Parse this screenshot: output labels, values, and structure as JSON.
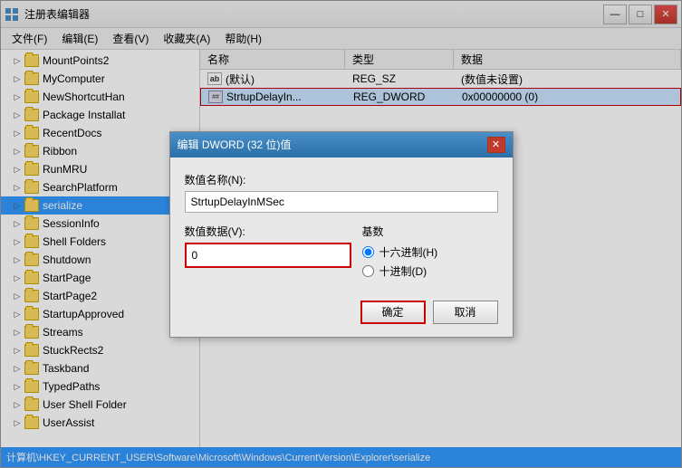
{
  "window": {
    "title": "注册表编辑器",
    "icon": "regedit",
    "controls": {
      "minimize": "—",
      "maximize": "□",
      "close": "✕"
    }
  },
  "menu": {
    "items": [
      {
        "label": "文件(F)"
      },
      {
        "label": "编辑(E)"
      },
      {
        "label": "查看(V)"
      },
      {
        "label": "收藏夹(A)"
      },
      {
        "label": "帮助(H)"
      }
    ]
  },
  "tree": {
    "items": [
      {
        "label": "MountPoints2",
        "indent": 1
      },
      {
        "label": "MyComputer",
        "indent": 1
      },
      {
        "label": "NewShortcutHan",
        "indent": 1
      },
      {
        "label": "Package Installat",
        "indent": 1
      },
      {
        "label": "RecentDocs",
        "indent": 1
      },
      {
        "label": "Ribbon",
        "indent": 1
      },
      {
        "label": "RunMRU",
        "indent": 1
      },
      {
        "label": "SearchPlatform",
        "indent": 1
      },
      {
        "label": "serialize",
        "indent": 1,
        "selected": true
      },
      {
        "label": "SessionInfo",
        "indent": 1
      },
      {
        "label": "Shell Folders",
        "indent": 1
      },
      {
        "label": "Shutdown",
        "indent": 1
      },
      {
        "label": "StartPage",
        "indent": 1
      },
      {
        "label": "StartPage2",
        "indent": 1
      },
      {
        "label": "StartupApproved",
        "indent": 1
      },
      {
        "label": "Streams",
        "indent": 1
      },
      {
        "label": "StuckRects2",
        "indent": 1
      },
      {
        "label": "Taskband",
        "indent": 1
      },
      {
        "label": "TypedPaths",
        "indent": 1
      },
      {
        "label": "User Shell Folder",
        "indent": 1
      },
      {
        "label": "UserAssist",
        "indent": 1
      }
    ]
  },
  "listview": {
    "headers": [
      "名称",
      "类型",
      "数据"
    ],
    "rows": [
      {
        "name": "(默认)",
        "icon": "ab",
        "type": "REG_SZ",
        "data": "(数值未设置)"
      },
      {
        "name": "StrtupDelayIn...",
        "icon": "dword",
        "type": "REG_DWORD",
        "data": "0x00000000 (0)",
        "selected": true
      }
    ]
  },
  "status_bar": {
    "text": "计算机\\HKEY_CURRENT_USER\\Software\\Microsoft\\Windows\\CurrentVersion\\Explorer\\serialize"
  },
  "modal": {
    "title": "编辑 DWORD (32 位)值",
    "close_btn": "✕",
    "name_label": "数值名称(N):",
    "name_value": "StrtupDelayInMSec",
    "value_label": "数值数据(V):",
    "value_input": "0",
    "base_label": "基数",
    "base_options": [
      {
        "label": "十六进制(H)",
        "value": "hex",
        "checked": true
      },
      {
        "label": "十进制(D)",
        "value": "dec",
        "checked": false
      }
    ],
    "btn_ok": "确定",
    "btn_cancel": "取消"
  }
}
